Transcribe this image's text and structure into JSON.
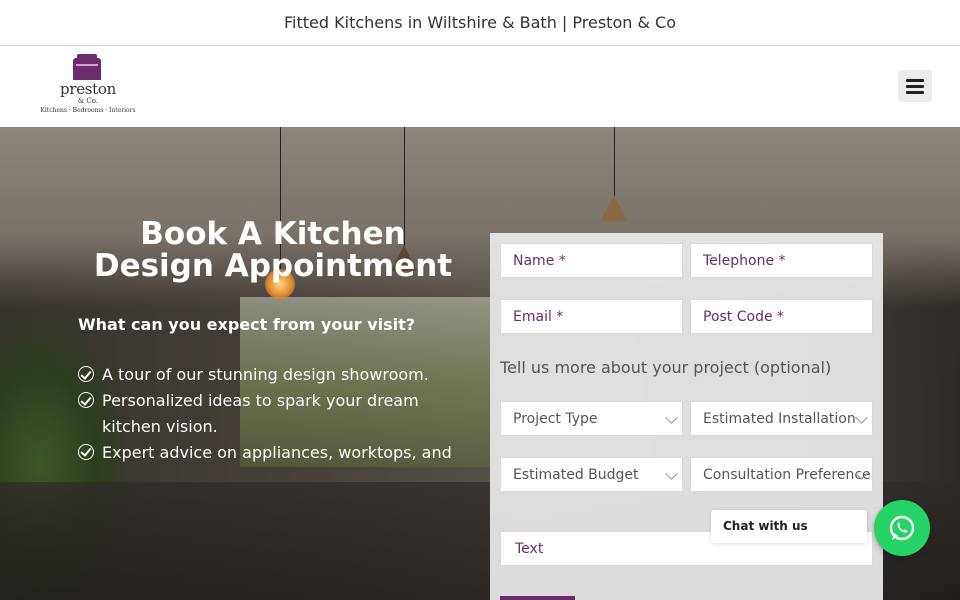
{
  "page_title": "Fitted Kitchens in Wiltshire & Bath | Preston & Co",
  "logo": {
    "brand": "preston",
    "co": "& Co.",
    "tagline": "Kitchens · Bedrooms · Interiors",
    "color": "#6b2c6b"
  },
  "menu": {
    "icon": "hamburger-icon"
  },
  "hero": {
    "headline": "Book A Kitchen Design Appointment",
    "subhead": "What can you expect from your visit?",
    "checklist": [
      "A tour of our stunning design showroom.",
      "Personalized ideas to spark your dream kitchen vision.",
      "Expert advice on appliances, worktops, and"
    ]
  },
  "form": {
    "name_placeholder": "Name *",
    "telephone_placeholder": "Telephone *",
    "email_placeholder": "Email *",
    "postcode_placeholder": "Post Code *",
    "note": "Tell us more about your project (optional)",
    "project_type": "Project Type",
    "installation": "Estimated Installation",
    "budget": "Estimated Budget",
    "consultation": "Consultation Preference",
    "text_placeholder": "Text"
  },
  "chat": {
    "label": "Chat with us",
    "icon": "whatsapp-icon",
    "color": "#25d366"
  }
}
